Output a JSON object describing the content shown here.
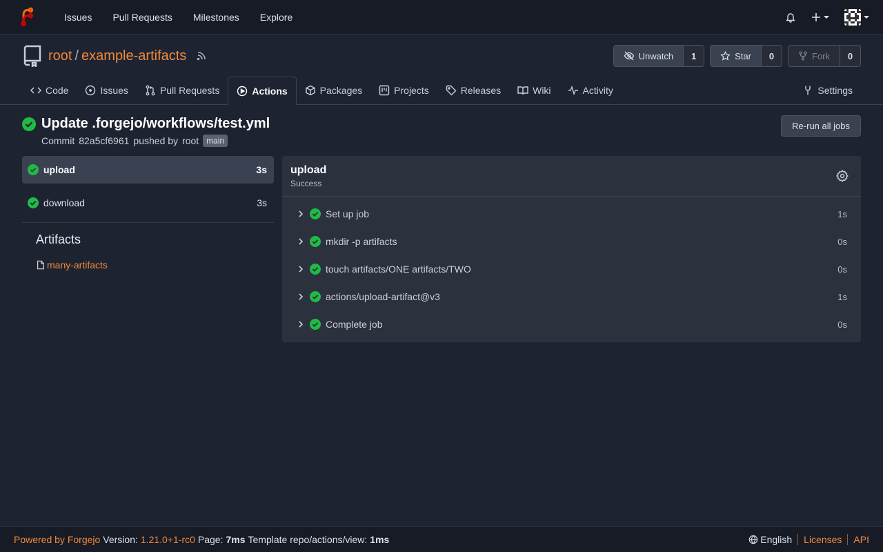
{
  "topnav": {
    "links": [
      "Issues",
      "Pull Requests",
      "Milestones",
      "Explore"
    ]
  },
  "repo": {
    "owner": "root",
    "separator": "/",
    "name": "example-artifacts",
    "watch_label": "Unwatch",
    "watch_count": "1",
    "star_label": "Star",
    "star_count": "0",
    "fork_label": "Fork",
    "fork_count": "0"
  },
  "tabs": {
    "code": "Code",
    "issues": "Issues",
    "pulls": "Pull Requests",
    "actions": "Actions",
    "packages": "Packages",
    "projects": "Projects",
    "releases": "Releases",
    "wiki": "Wiki",
    "activity": "Activity",
    "settings": "Settings"
  },
  "run": {
    "title": "Update .forgejo/workflows/test.yml",
    "commit_prefix": "Commit",
    "commit_sha": "82a5cf6961",
    "pushed_by": "pushed by",
    "pusher": "root",
    "branch": "main",
    "rerun_label": "Re-run all jobs"
  },
  "jobs": [
    {
      "name": "upload",
      "duration": "3s"
    },
    {
      "name": "download",
      "duration": "3s"
    }
  ],
  "artifacts": {
    "title": "Artifacts",
    "items": [
      "many-artifacts"
    ]
  },
  "job_detail": {
    "title": "upload",
    "status": "Success",
    "steps": [
      {
        "name": "Set up job",
        "duration": "1s"
      },
      {
        "name": "mkdir -p artifacts",
        "duration": "0s"
      },
      {
        "name": "touch artifacts/ONE artifacts/TWO",
        "duration": "0s"
      },
      {
        "name": "actions/upload-artifact@v3",
        "duration": "1s"
      },
      {
        "name": "Complete job",
        "duration": "0s"
      }
    ]
  },
  "footer": {
    "powered_by": "Powered by Forgejo",
    "version_label": "Version:",
    "version": "1.21.0+1-rc0",
    "page_label": "Page:",
    "page_time": "7ms",
    "template_label": "Template repo/actions/view:",
    "template_time": "1ms",
    "language": "English",
    "licenses": "Licenses",
    "api": "API"
  },
  "colors": {
    "accent": "#f08a3a",
    "success": "#21ba45",
    "background": "#1e2331"
  }
}
